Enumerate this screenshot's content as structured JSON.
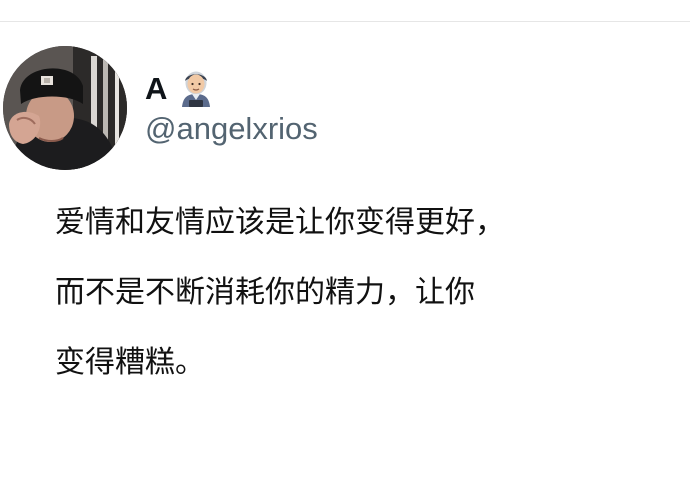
{
  "tweet": {
    "author": {
      "display_name": "A",
      "handle": "@angelxrios",
      "name_emoji": "man-technologist-emoji-icon",
      "avatar": "avatar-photo"
    },
    "text_lines": [
      "爱情和友情应该是让你变得更好，",
      "而不是不断消耗你的精力，让你",
      "变得糟糕。"
    ]
  },
  "colors": {
    "background": "#ffffff",
    "text": "#0f1419",
    "handle": "#536471",
    "divider": "#e6e6e6"
  }
}
